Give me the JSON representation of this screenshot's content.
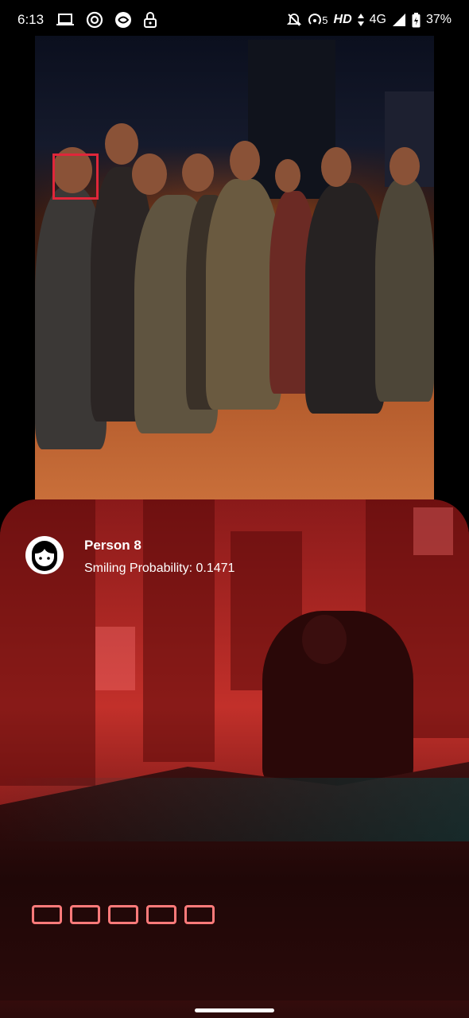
{
  "status_bar": {
    "time": "6:13",
    "left_icons": [
      "laptop-icon",
      "target-icon",
      "swirl-app-icon",
      "lock-icon"
    ],
    "right_icons": [
      "notifications-off-icon",
      "hotspot-icon",
      "signal-icon",
      "battery-icon"
    ],
    "hotspot_count": "5",
    "hd_label": "HD",
    "network_label": "4G",
    "battery_percent": "37%"
  },
  "photo": {
    "face_box_color": "#e0263a"
  },
  "detail": {
    "avatar_icon": "face-icon",
    "title": "Person 8",
    "subtitle": "Smiling Probability: 0.1471"
  }
}
